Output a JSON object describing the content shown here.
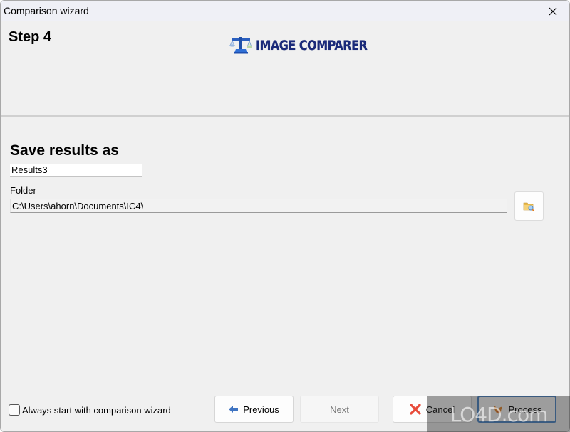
{
  "window": {
    "title": "Comparison wizard",
    "close_icon": "close-icon"
  },
  "header": {
    "step": "Step 4",
    "logo_text": "IMAGE COMPARER",
    "logo_icon": "balance-scale-icon"
  },
  "form": {
    "section_title": "Save results as",
    "name_value": "Results3",
    "folder_label": "Folder",
    "folder_value": "C:\\Users\\ahorn\\Documents\\IC4\\",
    "browse_icon": "folder-search-icon"
  },
  "footer": {
    "checkbox_label": "Always start with comparison wizard",
    "checkbox_checked": false,
    "buttons": {
      "previous": "Previous",
      "next": "Next",
      "cancel": "Cancel",
      "process": "Process"
    }
  },
  "watermark": "LO4D.com"
}
